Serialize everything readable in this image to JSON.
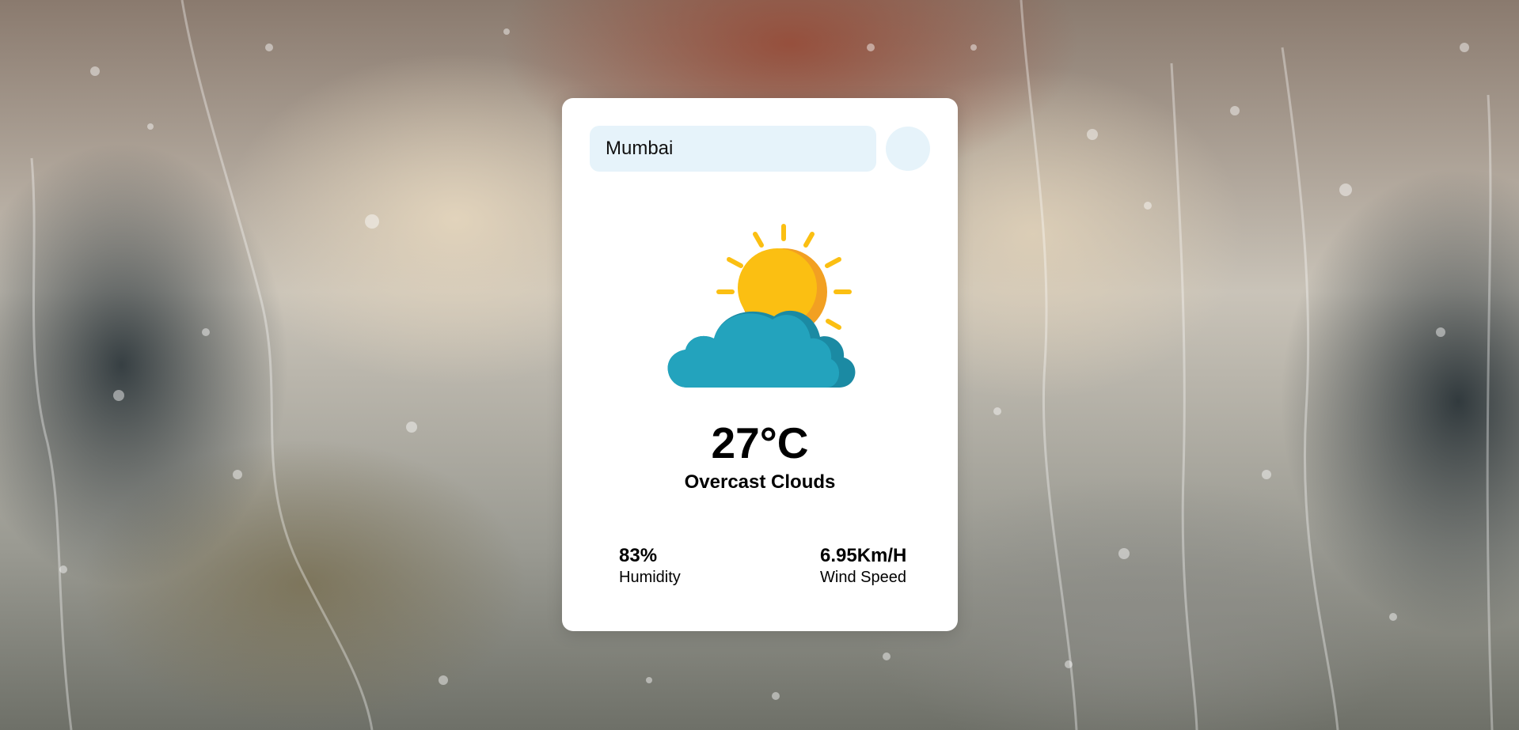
{
  "search": {
    "value": "Mumbai",
    "button_icon": "search-icon"
  },
  "weather": {
    "icon": "partly-cloudy-sun-icon",
    "temperature": "27°C",
    "description": "Overcast Clouds"
  },
  "stats": {
    "humidity": {
      "value": "83%",
      "label": "Humidity"
    },
    "wind": {
      "value": "6.95Km/H",
      "label": "Wind Speed"
    }
  },
  "colors": {
    "card": "#ffffff",
    "input_bg": "#e6f3fa",
    "sun": "#fbbf12",
    "sun_shadow": "#f2a022",
    "cloud": "#23a3bd",
    "cloud_shadow": "#1b8aa3"
  }
}
